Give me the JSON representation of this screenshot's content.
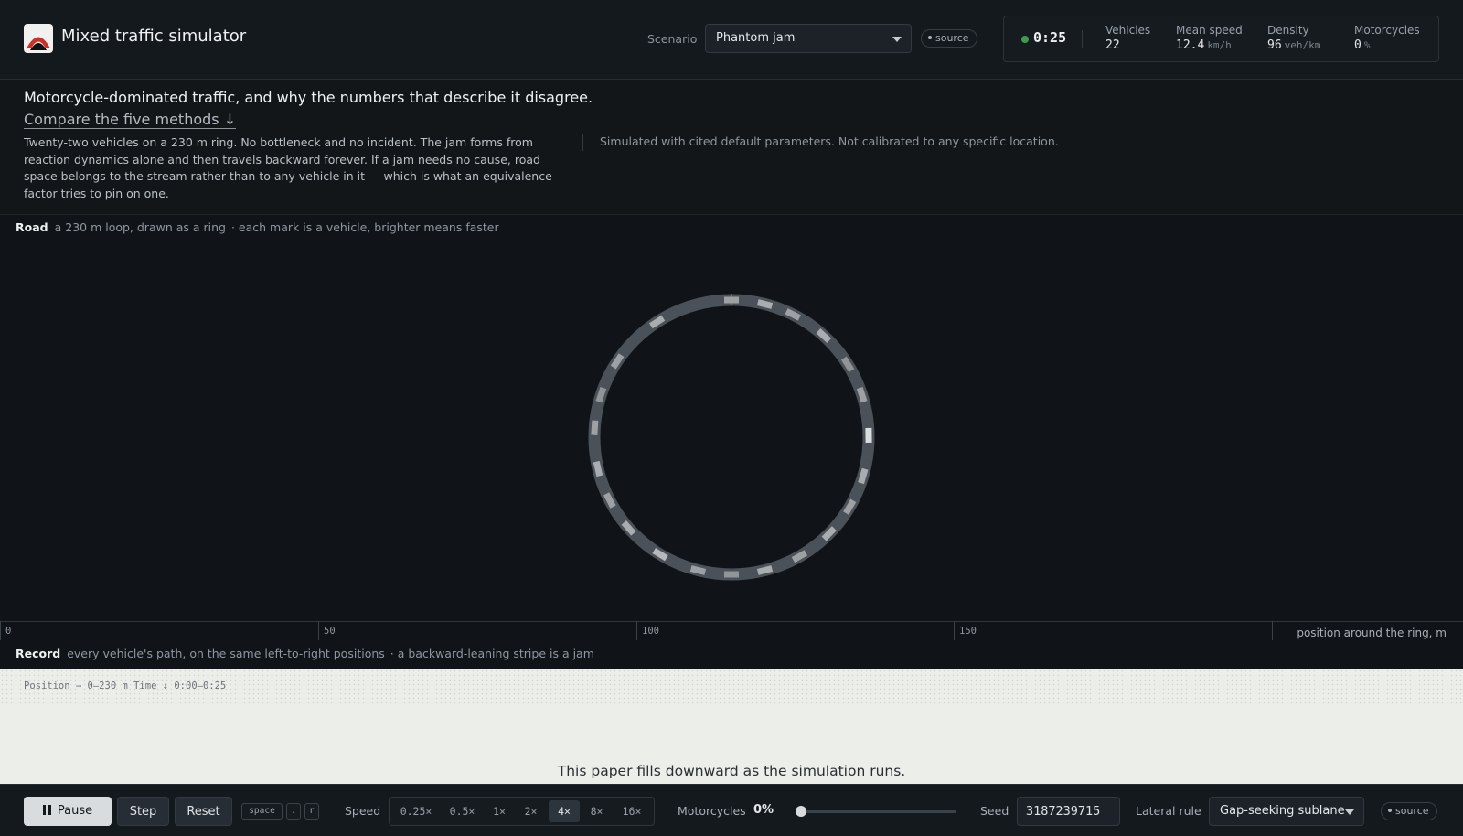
{
  "header": {
    "title": "Mixed traffic simulator",
    "scenario_label": "Scenario",
    "scenario_value": "Phantom jam",
    "source_label": "source",
    "clock": "0:25",
    "stats": [
      {
        "label": "Vehicles",
        "value": "22",
        "unit": ""
      },
      {
        "label": "Mean speed",
        "value": "12.4",
        "unit": "km/h"
      },
      {
        "label": "Density",
        "value": "96",
        "unit": "veh/km"
      },
      {
        "label": "Motorcycles",
        "value": "0",
        "unit": "%"
      }
    ]
  },
  "intro": {
    "headline": "Motorcycle-dominated traffic, and why the numbers that describe it disagree.",
    "compare_link": "Compare the five methods ↓",
    "description": "Twenty-two vehicles on a 230 m ring. No bottleneck and no incident. The jam forms from reaction dynamics alone and then travels backward forever. If a jam needs no cause, road space belongs to the stream rather than to any vehicle in it — which is what an equivalence factor tries to pin on one.",
    "disclaimer": "Simulated with cited default parameters. Not calibrated to any specific location."
  },
  "road": {
    "title": "Road",
    "subtitle": "a 230 m loop, drawn as a ring",
    "note": "· each mark is a vehicle, brighter means faster",
    "ring_length_m": 230,
    "vehicle_positions_m": [
      0,
      9,
      17,
      27,
      37,
      46,
      57,
      68,
      77,
      86,
      96,
      106,
      115,
      124,
      135,
      146,
      155,
      164,
      175,
      184,
      194,
      209
    ],
    "vehicle_speeds": [
      0.4,
      0.5,
      0.4,
      0.5,
      0.3,
      0.4,
      0.9,
      0.5,
      0.4,
      0.5,
      0.4,
      0.5,
      0.3,
      0.4,
      0.6,
      0.5,
      0.4,
      0.5,
      0.4,
      0.3,
      0.4,
      0.5
    ],
    "axis": {
      "ticks": [
        "0",
        "50",
        "100",
        "150"
      ],
      "tick_values_m": [
        0,
        50,
        100,
        150,
        200
      ],
      "title": "position around the ring, m"
    }
  },
  "record": {
    "title": "Record",
    "subtitle": "every vehicle's path, on the same left-to-right positions",
    "note": "· a backward-leaning stripe is a jam",
    "meta": "Position → 0–230 m   Time ↓ 0:00–0:25",
    "message": "This paper fills downward as the simulation runs."
  },
  "toolbar": {
    "pause_label": "Pause",
    "step_label": "Step",
    "reset_label": "Reset",
    "shortcuts": [
      "space",
      ".",
      "r"
    ],
    "speed_label": "Speed",
    "speed_options": [
      "0.25×",
      "0.5×",
      "1×",
      "2×",
      "4×",
      "8×",
      "16×"
    ],
    "speed_selected": "4×",
    "motorcycles_label": "Motorcycles",
    "motorcycles_value": "0%",
    "motorcycles_fraction": 0,
    "seed_label": "Seed",
    "seed_value": "3187239715",
    "lateral_label": "Lateral rule",
    "lateral_value": "Gap-seeking sublane",
    "source_label": "source"
  },
  "colors": {
    "background": "#101418",
    "paper": "#eceeea",
    "status_running": "#3d9a52"
  }
}
